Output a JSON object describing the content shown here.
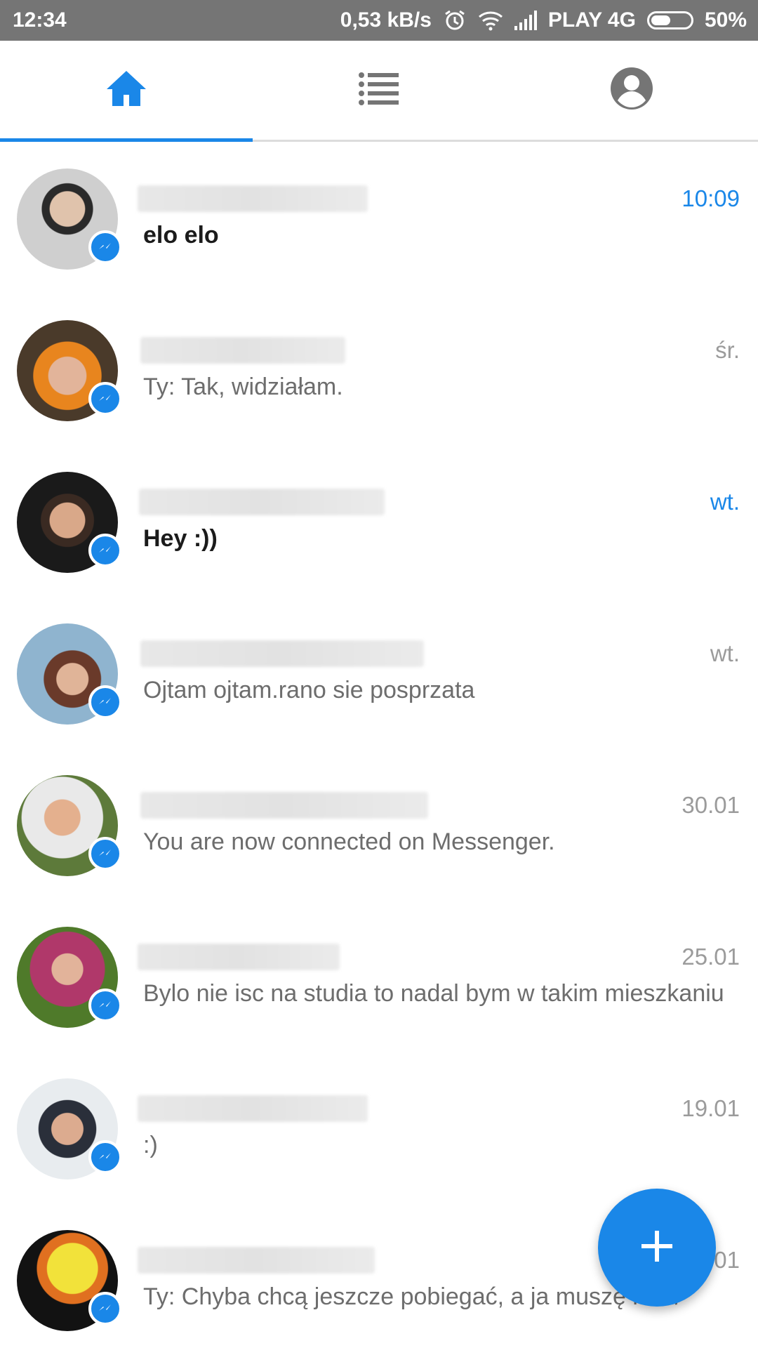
{
  "status_bar": {
    "time": "12:34",
    "speed": "0,53 kB/s",
    "carrier": "PLAY 4G",
    "battery": "50%",
    "battery_level": 0.5,
    "icons": [
      "alarm-icon",
      "wifi-icon",
      "signal-icon",
      "battery-icon"
    ]
  },
  "tabs": [
    {
      "icon": "home-icon",
      "selected": true
    },
    {
      "icon": "list-icon",
      "selected": false
    },
    {
      "icon": "profile-icon",
      "selected": false
    }
  ],
  "colors": {
    "accent": "#1a87e8",
    "status_bar": "#757575",
    "muted_text": "#6d6d6d"
  },
  "conversations": [
    {
      "snippet": "elo elo",
      "time": "10:09",
      "unread": true
    },
    {
      "snippet": "Ty: Tak, widziałam.",
      "time": "śr.",
      "unread": false
    },
    {
      "snippet": "Hey :))",
      "time": "wt.",
      "unread": true
    },
    {
      "snippet": "Ojtam ojtam.rano sie posprzata",
      "time": "wt.",
      "unread": false
    },
    {
      "snippet": "You are now connected on Messenger.",
      "time": "30.01",
      "unread": false
    },
    {
      "snippet": "Bylo nie isc na studia to nadal bym w takim mieszkaniu",
      "time": "25.01",
      "unread": false
    },
    {
      "snippet": ":)",
      "time": "19.01",
      "unread": false
    },
    {
      "snippet": "Ty: Chyba chcą jeszcze pobiegać, a ja muszę iść :/",
      "time": "17.01",
      "unread": false
    }
  ],
  "fab": {
    "icon": "plus-icon"
  }
}
